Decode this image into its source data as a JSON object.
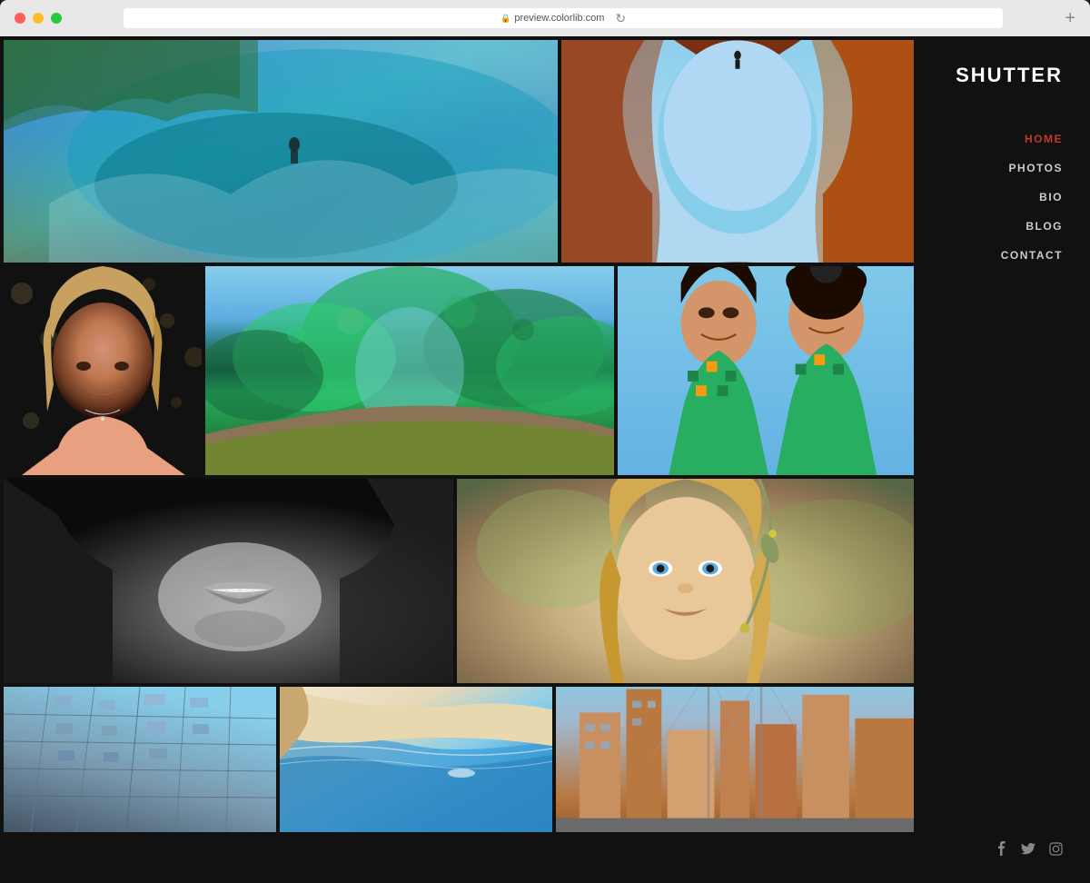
{
  "browser": {
    "url": "preview.colorlib.com",
    "lock_symbol": "🔒"
  },
  "site": {
    "logo": "SHUTTER"
  },
  "nav": {
    "items": [
      {
        "label": "HOME",
        "active": true
      },
      {
        "label": "PHOTOS",
        "active": false
      },
      {
        "label": "BIO",
        "active": false
      },
      {
        "label": "BLOG",
        "active": false
      },
      {
        "label": "CONTACT",
        "active": false
      }
    ]
  },
  "social": {
    "facebook": "f",
    "twitter": "t",
    "instagram": "ig"
  },
  "gallery": {
    "rows": [
      {
        "photos": [
          {
            "id": "p1-1",
            "alt": "Surfer in wave",
            "class": "p1-1"
          },
          {
            "id": "p1-2",
            "alt": "Red rock arch landscape",
            "class": "p1-2"
          }
        ]
      },
      {
        "photos": [
          {
            "id": "p2-1",
            "alt": "Girl portrait with bokeh lights",
            "class": "p2-1"
          },
          {
            "id": "p2-2",
            "alt": "Looking up through green trees",
            "class": "p2-2"
          },
          {
            "id": "p2-3",
            "alt": "Two women smiling",
            "class": "p2-3"
          }
        ]
      },
      {
        "photos": [
          {
            "id": "p3-1",
            "alt": "Black and white smile close up",
            "class": "p3-1"
          },
          {
            "id": "p3-2",
            "alt": "Blonde woman portrait outdoors",
            "class": "p3-2"
          }
        ]
      },
      {
        "photos": [
          {
            "id": "p4-1",
            "alt": "Building architecture looking up",
            "class": "p4-1"
          },
          {
            "id": "p4-2",
            "alt": "Aerial view of beach and water",
            "class": "p4-2"
          },
          {
            "id": "p4-3",
            "alt": "City street with bridge",
            "class": "p4-3"
          }
        ]
      }
    ]
  },
  "colors": {
    "accent": "#c0392b",
    "bg": "#111111",
    "nav_active": "#c0392b",
    "nav_inactive": "#cccccc"
  }
}
